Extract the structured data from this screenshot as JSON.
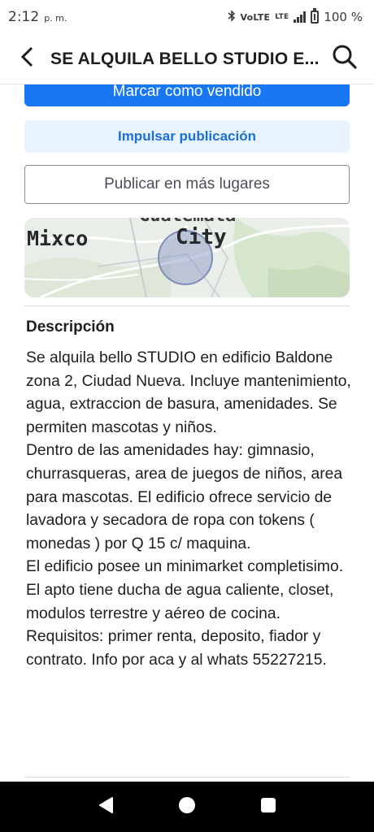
{
  "status_bar": {
    "time": "2:12",
    "ampm": "p. m.",
    "network": "VoLTE",
    "lte": "LTE",
    "battery": "100 %"
  },
  "header": {
    "title": "SE ALQUILA BELLO STUDIO E..."
  },
  "actions": {
    "mark_sold": "Marcar como vendido",
    "boost": "Impulsar publicación",
    "publish_more": "Publicar en más lugares"
  },
  "map": {
    "labels": {
      "partial": "Guatemala",
      "city": "City",
      "mixco": "Mixco"
    }
  },
  "description": {
    "heading": "Descripción",
    "paragraphs": [
      "Se alquila bello STUDIO en edificio Baldone zona 2, Ciudad Nueva. Incluye mantenimiento, agua, extraccion de basura, amenidades. Se permiten mascotas y niños.",
      "Dentro de las amenidades hay: gimnasio, churrasqueras, area de juegos de niños, area para mascotas. El edificio ofrece servicio de lavadora y secadora de ropa con tokens ( monedas ) por Q 15 c/ maquina.",
      "El edificio posee un minimarket completisimo. El apto tiene ducha de agua caliente, closet, modulos terrestre y aéreo de cocina.",
      "Requisitos: primer renta, deposito, fiador y contrato. Info por aca y al whats 55227215."
    ]
  },
  "colors": {
    "primary": "#1877f2",
    "boost_bg": "#e7f3ff",
    "boost_text": "#1b6fd6"
  },
  "icons": {
    "back": "back-arrow-icon",
    "search": "search-icon",
    "nav_back": "nav-back-icon",
    "nav_home": "nav-home-icon",
    "nav_recents": "nav-recents-icon"
  }
}
